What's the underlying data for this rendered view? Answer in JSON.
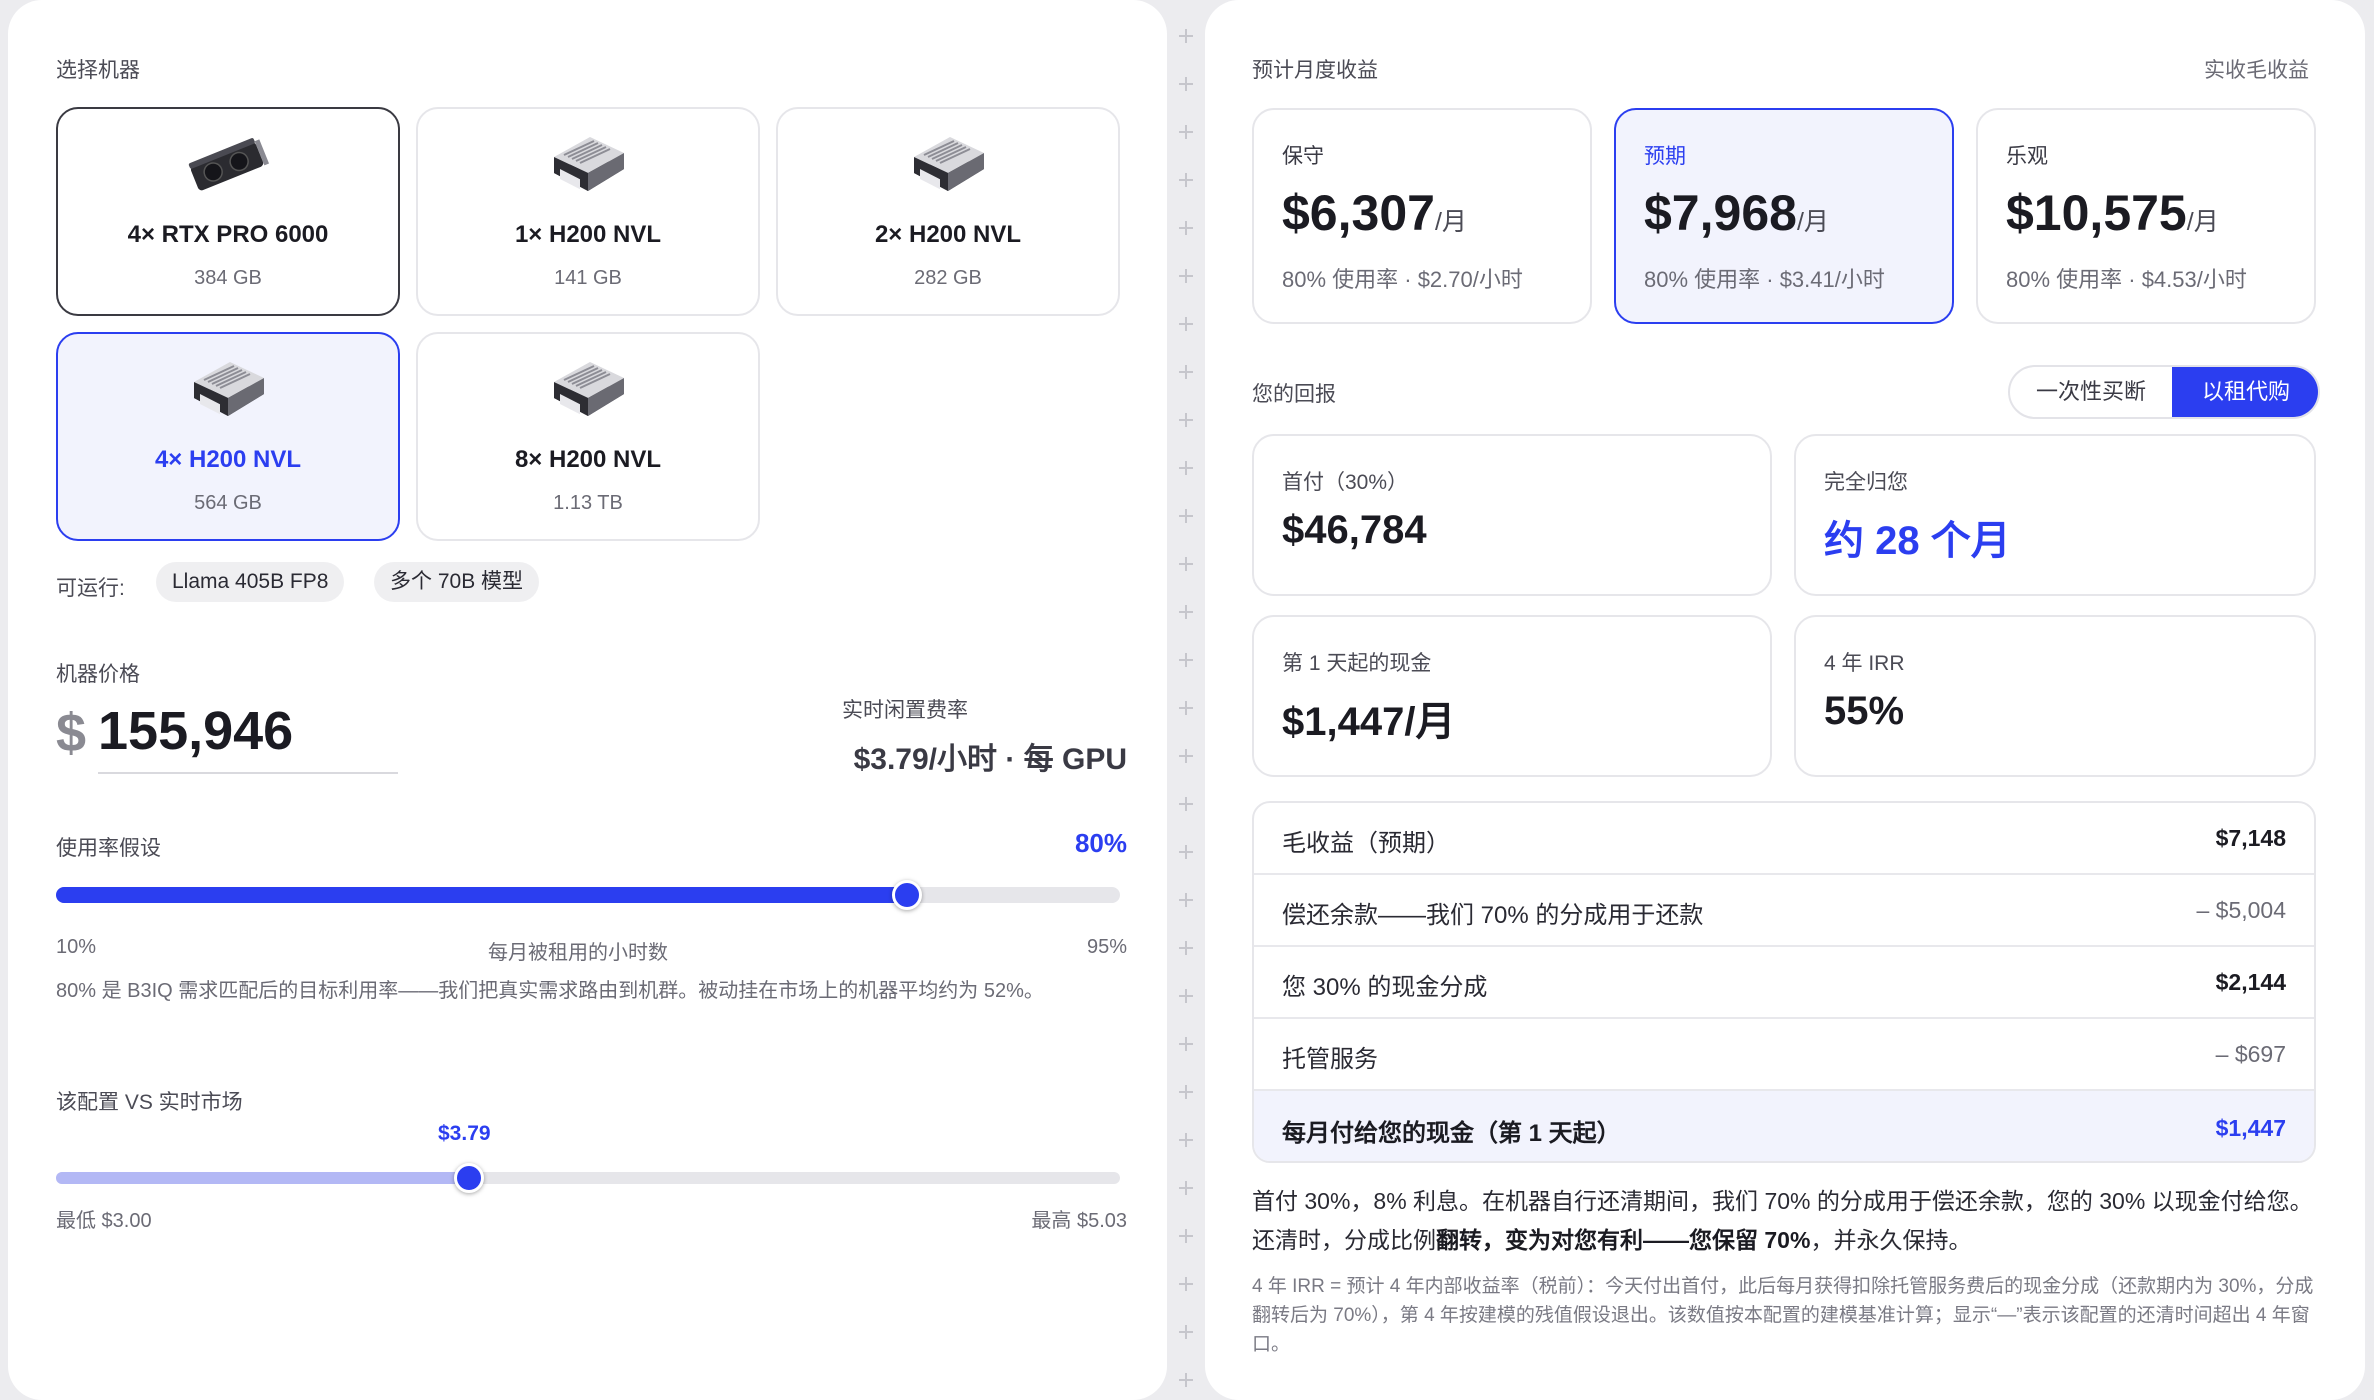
{
  "left": {
    "select_machine_label": "选择机器",
    "machines": [
      {
        "name": "4× RTX PRO 6000",
        "memory": "384 GB",
        "icon": "gpu-card-icon"
      },
      {
        "name": "1× H200 NVL",
        "memory": "141 GB",
        "icon": "server-icon"
      },
      {
        "name": "2× H200 NVL",
        "memory": "282 GB",
        "icon": "server-icon"
      },
      {
        "name": "4× H200 NVL",
        "memory": "564 GB",
        "icon": "server-icon",
        "selected": true
      },
      {
        "name": "8× H200 NVL",
        "memory": "1.13 TB",
        "icon": "server-icon"
      }
    ],
    "can_run_label": "可运行:",
    "can_run_chips": [
      "Llama 405B FP8",
      "多个 70B 模型"
    ],
    "machine_price_label": "机器价格",
    "currency_symbol": "$",
    "machine_price_value": "155,946",
    "idle_rate_label": "实时闲置费率",
    "idle_rate_value": "$3.79/小时 · 每 GPU",
    "utilization_label": "使用率假设",
    "utilization_value": "80%",
    "utilization_fraction": 0.8,
    "utilization_min": "10%",
    "utilization_mid_label": "每月被租用的小时数",
    "utilization_max": "95%",
    "utilization_note": "80% 是 B3IQ 需求匹配后的目标利用率——我们把真实需求路由到机群。被动挂在市场上的机器平均约为 52%。",
    "market_label": "该配置 VS 实时市场",
    "market_marker_value": "$3.79",
    "market_min": "最低 $3.00",
    "market_max": "最高 $5.03"
  },
  "right": {
    "monthly_label": "预计月度收益",
    "gross_link": "实收毛收益",
    "scenarios": [
      {
        "title": "保守",
        "price": "$6,307",
        "unit": "/月",
        "sub": "80% 使用率 · $2.70/小时"
      },
      {
        "title": "预期",
        "price": "$7,968",
        "unit": "/月",
        "sub": "80% 使用率 · $3.41/小时",
        "selected": true
      },
      {
        "title": "乐观",
        "price": "$10,575",
        "unit": "/月",
        "sub": "80% 使用率 · $4.53/小时"
      }
    ],
    "returns_label": "您的回报",
    "toggle": {
      "option_a": "一次性买断",
      "option_b": "以租代购",
      "active": "option_b"
    },
    "returns": [
      {
        "title": "首付（30%）",
        "value": "$46,784"
      },
      {
        "title": "完全归您",
        "value": "约 28 个月",
        "accent": true
      },
      {
        "title": "第 1 天起的现金",
        "value": "$1,447/月"
      },
      {
        "title": "4 年 IRR",
        "value": "55%"
      }
    ],
    "breakdown": [
      {
        "label": "毛收益（预期）",
        "value": "$7,148"
      },
      {
        "label": "偿还余款——我们 70% 的分成用于还款",
        "value": "– $5,004"
      },
      {
        "label": "您 30% 的现金分成",
        "value": "$2,144"
      },
      {
        "label": "托管服务",
        "value": "– $697"
      }
    ],
    "total": {
      "label": "每月付给您的现金（第 1 天起）",
      "value": "$1,447"
    },
    "note_part1": "首付 30%，8% 利息。在机器自行还清期间，我们 70% 的分成用于偿还余款，您的 30% 以现金付给您。还清时，分成比例",
    "note_bold": "翻转，变为对您有利——您保留 70%",
    "note_part2": "，并永久保持。",
    "footnote": "4 年 IRR = 预计 4 年内部收益率（税前）：今天付出首付，此后每月获得扣除托管服务费后的现金分成（还款期内为 30%，分成翻转后为 70%），第 4 年按建模的残值假设退出。该数值按本配置的建模基准计算；显示“—”表示该配置的还清时间超出 4 年窗口。"
  },
  "colors": {
    "accent": "#2b3ef0",
    "accent_soft": "#f2f3fd",
    "track": "#e6e6ea",
    "market_fill": "#b3b8f5"
  }
}
